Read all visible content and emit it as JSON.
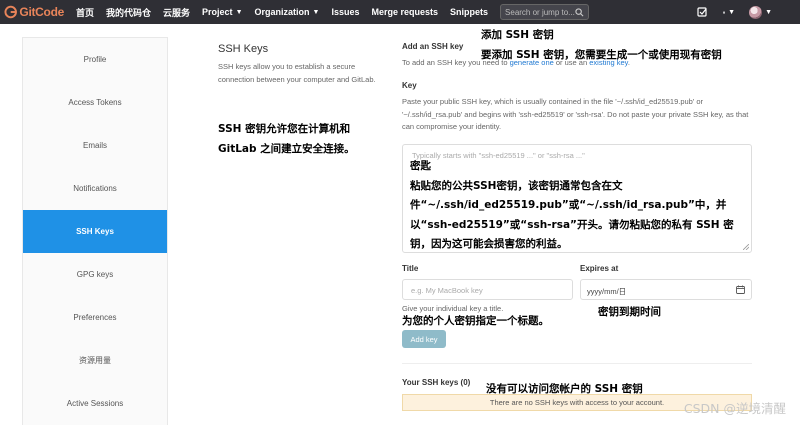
{
  "navbar": {
    "logo_text": "GitCode",
    "items": [
      "首页",
      "我的代码仓",
      "云服务",
      "Project",
      "Organization",
      "Issues",
      "Merge requests",
      "Snippets"
    ],
    "search_placeholder": "Search or jump to...",
    "bg_color": "#2f2f35",
    "logo_color": "#e8845a"
  },
  "sidebar": {
    "items": [
      {
        "label": "Profile"
      },
      {
        "label": "Access Tokens"
      },
      {
        "label": "Emails"
      },
      {
        "label": "Notifications"
      },
      {
        "label": "SSH Keys",
        "active": true
      },
      {
        "label": "GPG keys"
      },
      {
        "label": "Preferences"
      },
      {
        "label": "资源用量"
      },
      {
        "label": "Active Sessions"
      }
    ],
    "active_color": "#1f91e6"
  },
  "description": {
    "title": "SSH Keys",
    "text": "SSH keys allow you to establish a secure connection between your computer and GitLab.",
    "annotation": "SSH 密钥允许您在计算机和GitLab 之间建立安全连接。"
  },
  "form": {
    "add_heading": "Add an SSH key",
    "add_subtitle_prefix": "To add an SSH key you need to ",
    "add_subtitle_link1": "generate one",
    "add_subtitle_mid": " or use an ",
    "add_subtitle_link2": "existing key",
    "add_subtitle_suffix": ".",
    "annotation_title": "添加 SSH 密钥",
    "annotation_subtitle": "要添加 SSH 密钥，您需要生成一个或使用现有密钥",
    "key_label": "Key",
    "key_help": "Paste your public SSH key, which is usually contained in the file '~/.ssh/id_ed25519.pub' or '~/.ssh/id_rsa.pub' and begins with 'ssh-ed25519' or 'ssh-rsa'. Do not paste your private SSH key, as that can compromise your identity.",
    "key_placeholder": "Typically starts with \"ssh-ed25519 ...\" or \"ssh-rsa ...\"",
    "key_annotation": "密匙\n粘贴您的公共SSH密钥，该密钥通常包含在文件“~/.ssh/id_ed25519.pub”或“~/.ssh/id_rsa.pub”中，并以“ssh-ed25519”或“ssh-rsa”开头。请勿粘贴您的私有 SSH 密钥，因为这可能会损害您的利益。",
    "title_label": "Title",
    "title_placeholder": "e.g. My MacBook key",
    "title_help": "Give your individual key a title.",
    "title_annotation": "为您的个人密钥指定一个标题。",
    "expires_label": "Expires at",
    "expires_placeholder": "yyyy/mm/日",
    "expires_annotation": "密钥到期时间",
    "add_button": "Add key",
    "add_button_color": "#8fbbc9"
  },
  "your_keys": {
    "heading": "Your SSH keys (0)",
    "empty_text": "There are no SSH keys with access to your account.",
    "annotation": "没有可以访问您帐户的 SSH 密钥",
    "empty_bg": "#fdf1dd"
  },
  "watermark": "CSDN @逆境清醒"
}
